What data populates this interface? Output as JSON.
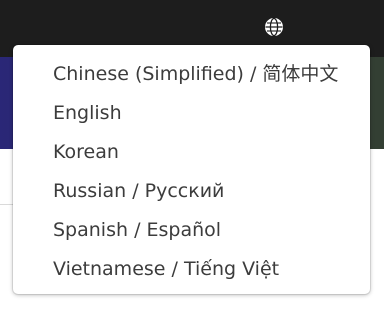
{
  "header": {
    "language_icon": "globe-icon"
  },
  "language_menu": {
    "items": [
      {
        "label": "Chinese (Simplified) / 简体中文"
      },
      {
        "label": "English"
      },
      {
        "label": "Korean"
      },
      {
        "label": "Russian / Русский"
      },
      {
        "label": "Spanish / Español"
      },
      {
        "label": "Vietnamese / Tiếng Việt"
      }
    ]
  },
  "colors": {
    "topbar": "#1d1d1d",
    "banner_left": "#2a2777",
    "banner_right": "#343c3c",
    "menu_text": "#3c3c3c"
  }
}
